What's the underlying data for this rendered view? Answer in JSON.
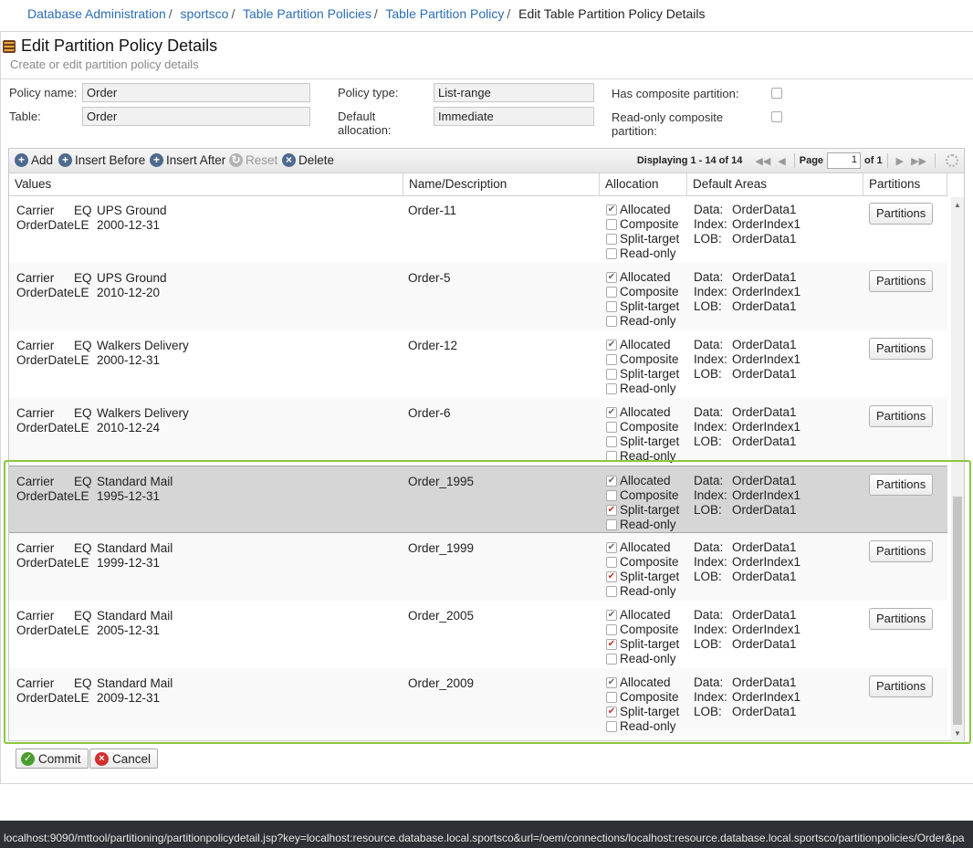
{
  "breadcrumb": {
    "items": [
      "Database Administration",
      "sportsco",
      "Table Partition Policies",
      "Table Partition Policy"
    ],
    "current": "Edit Table Partition Policy Details"
  },
  "header": {
    "title": "Edit Partition Policy Details",
    "subtitle": "Create or edit partition policy details",
    "icon": "database-icon"
  },
  "form": {
    "policy_name_label": "Policy name:",
    "policy_name_value": "Order",
    "table_label": "Table:",
    "table_value": "Order",
    "policy_type_label": "Policy type:",
    "policy_type_value": "List-range",
    "default_allocation_label": "Default allocation:",
    "default_allocation_value": "Immediate",
    "has_composite_label": "Has composite partition:",
    "readonly_composite_label": "Read-only composite partition:"
  },
  "toolbar": {
    "add": "Add",
    "insert_before": "Insert Before",
    "insert_after": "Insert After",
    "reset": "Reset",
    "delete": "Delete"
  },
  "pager": {
    "displaying": "Displaying 1 - 14 of 14",
    "page_label": "Page",
    "page_value": "1",
    "of_label": "of 1"
  },
  "table": {
    "columns": [
      "Values",
      "Name/Description",
      "Allocation",
      "Default Areas",
      "Partitions"
    ],
    "allocation_labels": [
      "Allocated",
      "Composite",
      "Split-target",
      "Read-only"
    ],
    "area_keys": [
      "Data:",
      "Index:",
      "LOB:"
    ],
    "partitions_button": "Partitions",
    "rows": [
      {
        "c1": "Carrier",
        "o1": "EQ",
        "v1": "UPS Ground",
        "c2": "OrderDate",
        "o2": "LE",
        "v2": "2000-12-31",
        "name": "Order-11",
        "data": "OrderData1",
        "index": "OrderIndex1",
        "lob": "OrderData1"
      },
      {
        "c1": "Carrier",
        "o1": "EQ",
        "v1": "UPS Ground",
        "c2": "OrderDate",
        "o2": "LE",
        "v2": "2010-12-20",
        "name": "Order-5",
        "data": "OrderData1",
        "index": "OrderIndex1",
        "lob": "OrderData1"
      },
      {
        "c1": "Carrier",
        "o1": "EQ",
        "v1": "Walkers Delivery",
        "c2": "OrderDate",
        "o2": "LE",
        "v2": "2000-12-31",
        "name": "Order-12",
        "data": "OrderData1",
        "index": "OrderIndex1",
        "lob": "OrderData1"
      },
      {
        "c1": "Carrier",
        "o1": "EQ",
        "v1": "Walkers Delivery",
        "c2": "OrderDate",
        "o2": "LE",
        "v2": "2010-12-24",
        "name": "Order-6",
        "data": "OrderData1",
        "index": "OrderIndex1",
        "lob": "OrderData1"
      },
      {
        "c1": "Carrier",
        "o1": "EQ",
        "v1": "Standard Mail",
        "c2": "OrderDate",
        "o2": "LE",
        "v2": "1995-12-31",
        "name": "Order_1995",
        "data": "OrderData1",
        "index": "OrderIndex1",
        "lob": "OrderData1"
      },
      {
        "c1": "Carrier",
        "o1": "EQ",
        "v1": "Standard Mail",
        "c2": "OrderDate",
        "o2": "LE",
        "v2": "1999-12-31",
        "name": "Order_1999",
        "data": "OrderData1",
        "index": "OrderIndex1",
        "lob": "OrderData1"
      },
      {
        "c1": "Carrier",
        "o1": "EQ",
        "v1": "Standard Mail",
        "c2": "OrderDate",
        "o2": "LE",
        "v2": "2005-12-31",
        "name": "Order_2005",
        "data": "OrderData1",
        "index": "OrderIndex1",
        "lob": "OrderData1"
      },
      {
        "c1": "Carrier",
        "o1": "EQ",
        "v1": "Standard Mail",
        "c2": "OrderDate",
        "o2": "LE",
        "v2": "2009-12-31",
        "name": "Order_2009",
        "data": "OrderData1",
        "index": "OrderIndex1",
        "lob": "OrderData1"
      }
    ]
  },
  "actions": {
    "commit": "Commit",
    "cancel": "Cancel"
  },
  "status_url": "localhost:9090/mttool/partitioning/partitionpolicydetail.jsp?key=localhost:resource.database.local.sportsco&url=/oem/connections/localhost:resource.database.local.sportsco/partitionpolicies/Order&pa",
  "colors": {
    "link": "#2a6db5",
    "highlight_border": "#8cc63f",
    "selected_row": "#d6d6d6",
    "status_bar": "#2d3034"
  }
}
